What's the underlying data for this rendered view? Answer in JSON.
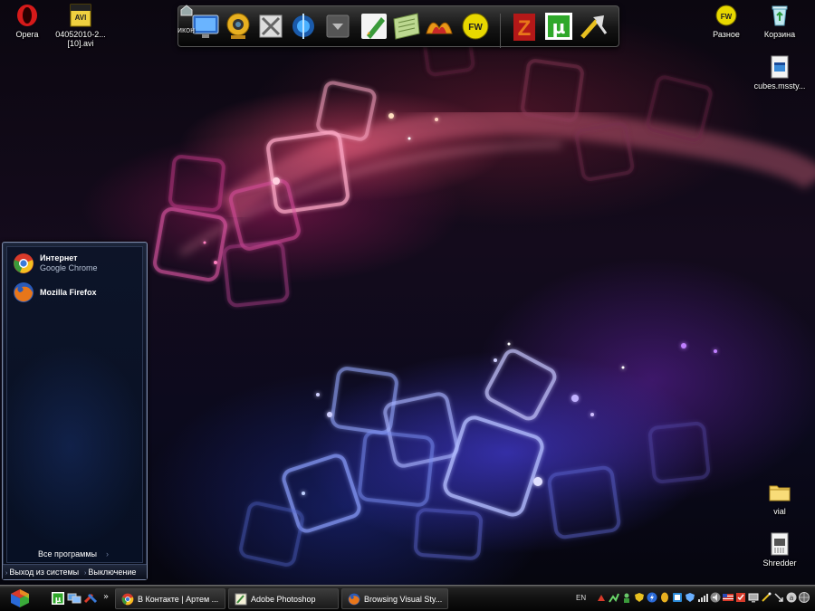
{
  "desktop": {
    "icons": [
      {
        "id": "opera",
        "label": "Opera"
      },
      {
        "id": "avi",
        "label": "04052010-2... [10].avi"
      },
      {
        "id": "raznoe",
        "label": "Разное"
      },
      {
        "id": "korzina",
        "label": "Корзина"
      },
      {
        "id": "cubes",
        "label": "cubes.mssty..."
      },
      {
        "id": "vial",
        "label": "vial"
      },
      {
        "id": "shredder",
        "label": "Shredder"
      }
    ]
  },
  "dock": {
    "partial_label": "икон",
    "items": [
      "computer",
      "webcam",
      "tools",
      "bluetooth",
      "arrow",
      "pen",
      "notes",
      "flower",
      "fw",
      "filezilla",
      "utorrent",
      "wrench"
    ]
  },
  "start_menu": {
    "pinned": [
      {
        "title": "Интернет",
        "subtitle": "Google Chrome",
        "icon": "chrome-icon"
      },
      {
        "title": "Mozilla Firefox",
        "subtitle": "",
        "icon": "firefox-icon"
      }
    ],
    "all_programs": "Все программы",
    "logoff": "Выход из системы",
    "shutdown": "Выключение"
  },
  "taskbar": {
    "more": "»",
    "tasks": [
      {
        "label": "В Контакте | Артем ...",
        "icon": "chrome-icon"
      },
      {
        "label": "Adobe Photoshop",
        "icon": "photoshop-icon"
      },
      {
        "label": "Browsing Visual Sty...",
        "icon": "firefox-icon"
      }
    ],
    "language": "EN"
  },
  "colors": {
    "taskbar_bg": "#111111",
    "start_menu_border": "#7d8aa8",
    "utorrent_green": "#2fa82a",
    "filezilla_orange": "#e8761a"
  }
}
